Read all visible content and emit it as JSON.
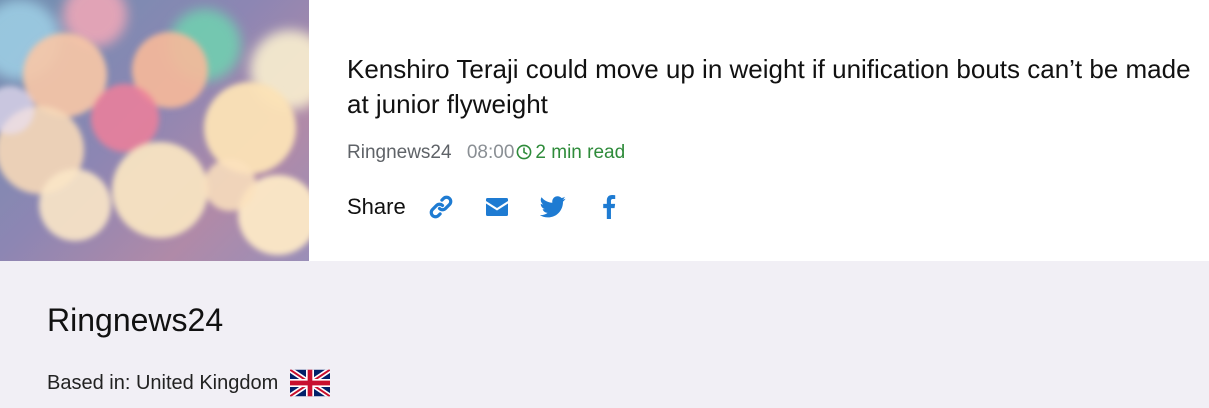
{
  "article": {
    "title": "Kenshiro Teraji could move up in weight if unification bouts can’t be made at junior flyweight",
    "source": "Ringnews24",
    "time": "08:00",
    "read_time": "2 min read",
    "share_label": "Share",
    "share_buttons": [
      "link-icon",
      "email-icon",
      "twitter-icon",
      "facebook-icon"
    ],
    "thumbnail": "bokeh-lights-image"
  },
  "source_info": {
    "name": "Ringnews24",
    "based_in": "Based in: United Kingdom",
    "flag": "uk-flag-icon"
  },
  "colors": {
    "accent_blue": "#1e7bd2",
    "read_time_green": "#2e8b3a",
    "source_block_bg": "#f1eff5"
  }
}
